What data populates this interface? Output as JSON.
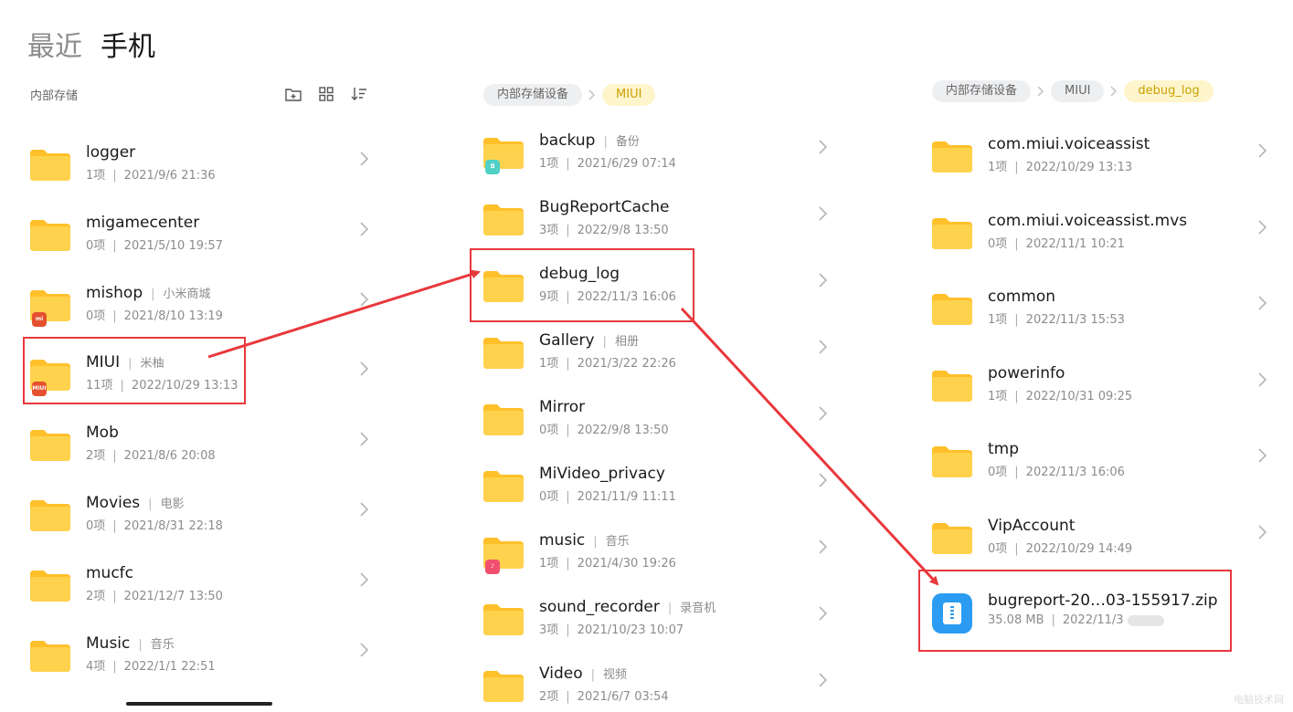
{
  "tabs": {
    "recent": "最近",
    "phone": "手机"
  },
  "storage_label": "内部存储",
  "toolbar": {
    "new_folder_icon": "folder-plus-icon",
    "grid_icon": "grid-view-icon",
    "sort_icon": "sort-icon"
  },
  "col2_crumbs": [
    "内部存储设备",
    "MIUI"
  ],
  "col3_crumbs": [
    "内部存储设备",
    "MIUI",
    "debug_log"
  ],
  "colors": {
    "folder": "#FFC02A",
    "folder_front": "#FFD24D",
    "accent_red": "#E8383D",
    "zip_blue": "#2B9CF2",
    "crumb_active_bg": "#FFF5CC"
  },
  "col1": [
    {
      "name": "logger",
      "tag": "",
      "count": "1项",
      "date": "2021/9/6 21:36"
    },
    {
      "name": "migamecenter",
      "tag": "",
      "count": "0项",
      "date": "2021/5/10 19:57"
    },
    {
      "name": "mishop",
      "tag": "小米商城",
      "count": "0项",
      "date": "2021/8/10 13:19",
      "badge": "mi",
      "badge_color": "#E5502E"
    },
    {
      "name": "MIUI",
      "tag": "米柚",
      "count": "11项",
      "date": "2022/10/29 13:13",
      "badge": "MIUI",
      "badge_color": "#E5502E"
    },
    {
      "name": "Mob",
      "tag": "",
      "count": "2项",
      "date": "2021/8/6 20:08"
    },
    {
      "name": "Movies",
      "tag": "电影",
      "count": "0项",
      "date": "2021/8/31 22:18"
    },
    {
      "name": "mucfc",
      "tag": "",
      "count": "2项",
      "date": "2021/12/7 13:50"
    },
    {
      "name": "Music",
      "tag": "音乐",
      "count": "4项",
      "date": "2022/1/1 22:51"
    }
  ],
  "col2": [
    {
      "name": "backup",
      "tag": "备份",
      "count": "1项",
      "date": "2021/6/29 07:14",
      "badge": "◘",
      "badge_color": "#4FD1C5"
    },
    {
      "name": "BugReportCache",
      "tag": "",
      "count": "3项",
      "date": "2022/9/8 13:50"
    },
    {
      "name": "debug_log",
      "tag": "",
      "count": "9项",
      "date": "2022/11/3 16:06"
    },
    {
      "name": "Gallery",
      "tag": "相册",
      "count": "1项",
      "date": "2021/3/22 22:26"
    },
    {
      "name": "Mirror",
      "tag": "",
      "count": "0项",
      "date": "2022/9/8 13:50"
    },
    {
      "name": "MiVideo_privacy",
      "tag": "",
      "count": "0项",
      "date": "2021/11/9 11:11"
    },
    {
      "name": "music",
      "tag": "音乐",
      "count": "1项",
      "date": "2021/4/30 19:26",
      "badge": "♪",
      "badge_color": "#F0506E"
    },
    {
      "name": "sound_recorder",
      "tag": "录音机",
      "count": "3项",
      "date": "2021/10/23 10:07"
    },
    {
      "name": "Video",
      "tag": "视频",
      "count": "2项",
      "date": "2021/6/7 03:54"
    }
  ],
  "col3": [
    {
      "name": "com.miui.voiceassist",
      "tag": "",
      "count": "1项",
      "date": "2022/10/29 13:13"
    },
    {
      "name": "com.miui.voiceassist.mvs",
      "tag": "",
      "count": "0项",
      "date": "2022/11/1 10:21"
    },
    {
      "name": "common",
      "tag": "",
      "count": "1项",
      "date": "2022/11/3 15:53"
    },
    {
      "name": "powerinfo",
      "tag": "",
      "count": "1项",
      "date": "2022/10/31 09:25"
    },
    {
      "name": "tmp",
      "tag": "",
      "count": "0项",
      "date": "2022/11/3 16:06"
    },
    {
      "name": "VipAccount",
      "tag": "",
      "count": "0项",
      "date": "2022/10/29 14:49"
    }
  ],
  "zip_file": {
    "name": "bugreport-20…03-155917.zip",
    "size": "35.08 MB",
    "date": "2022/11/3",
    "icon": "zip-file-icon"
  },
  "watermark": "电脑技术网"
}
